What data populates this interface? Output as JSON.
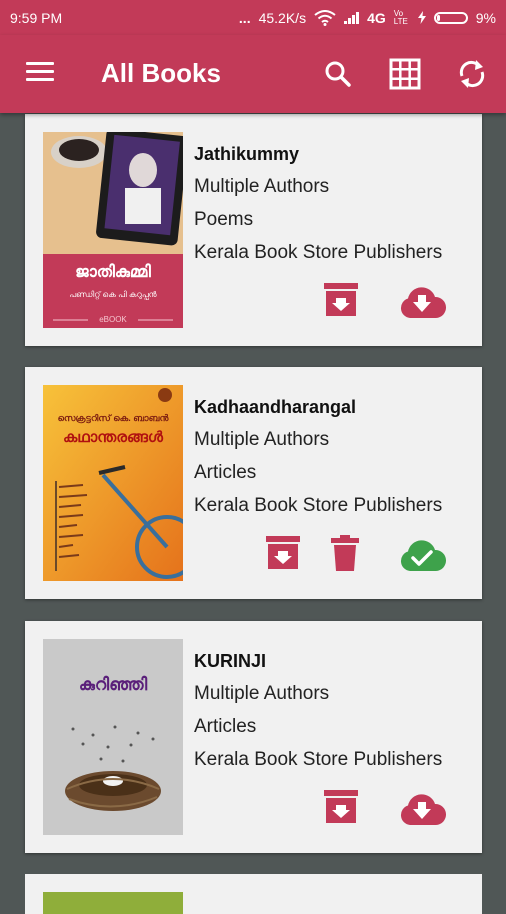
{
  "status": {
    "time": "9:59 PM",
    "dots": "...",
    "speed": "45.2K/s",
    "network": "4G",
    "volte": "Vo LTE",
    "battery": "9%"
  },
  "appbar": {
    "title": "All Books",
    "icons": [
      "menu-icon",
      "search-icon",
      "grid-view-icon",
      "sync-icon"
    ]
  },
  "books": [
    {
      "title": "Jathikummy",
      "author": "Multiple Authors",
      "category": "Poems",
      "publisher": "Kerala Book Store Publishers",
      "cover_title": "ജാതികുമ്മി",
      "cover_author": "പണ്ഡിറ്റ് കെ പി കറുപ്പൻ",
      "cover_badge": "eBOOK",
      "downloaded": false
    },
    {
      "title": "Kadhaandharangal",
      "author": "Multiple Authors",
      "category": "Articles",
      "publisher": "Kerala Book Store Publishers",
      "cover_author": "സെക്രട്ടറിസ് കെ. ബാബൻ",
      "cover_title": "കഥാന്തരങ്ങൾ",
      "downloaded": true
    },
    {
      "title": "KURINJI",
      "author": "Multiple Authors",
      "category": "Articles",
      "publisher": "Kerala Book Store Publishers",
      "cover_title": "കുറിഞ്ഞി",
      "downloaded": false
    }
  ],
  "colors": {
    "primary": "#c23a58",
    "background": "#505756",
    "card": "#f1f1f1",
    "success": "#3ea24b"
  }
}
